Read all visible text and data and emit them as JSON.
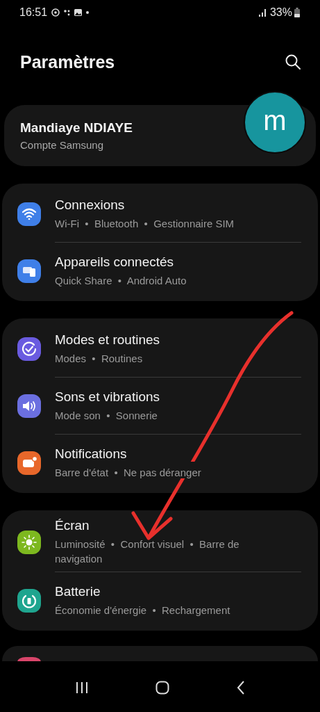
{
  "status_bar": {
    "time": "16:51",
    "battery": "33%"
  },
  "header": {
    "title": "Paramètres"
  },
  "profile": {
    "name": "Mandiaye NDIAYE",
    "account": "Compte Samsung",
    "avatar_letter": "m"
  },
  "groups": [
    {
      "items": [
        {
          "kind": "wifi",
          "color": "#3f7fe8",
          "title": "Connexions",
          "subtitle": "Wi-Fi  •  Bluetooth  •  Gestionnaire SIM"
        },
        {
          "kind": "devices",
          "color": "#3f7fe8",
          "title": "Appareils connectés",
          "subtitle": "Quick Share  •  Android Auto"
        }
      ]
    },
    {
      "items": [
        {
          "kind": "modes",
          "color": "#6a5be0",
          "title": "Modes et routines",
          "subtitle": "Modes  •  Routines"
        },
        {
          "kind": "sound",
          "color": "#6b6fe0",
          "title": "Sons et vibrations",
          "subtitle": "Mode son  •  Sonnerie"
        },
        {
          "kind": "notifications",
          "color": "#e8672a",
          "title": "Notifications",
          "subtitle": "Barre d'état  •  Ne pas déranger"
        }
      ]
    },
    {
      "items": [
        {
          "kind": "display",
          "color": "#7db81f",
          "title": "Écran",
          "subtitle": "Luminosité  •  Confort visuel  •  Barre de navigation"
        },
        {
          "kind": "battery",
          "color": "#1fa58f",
          "title": "Batterie",
          "subtitle": "Économie d'énergie  •  Rechargement"
        }
      ]
    }
  ]
}
